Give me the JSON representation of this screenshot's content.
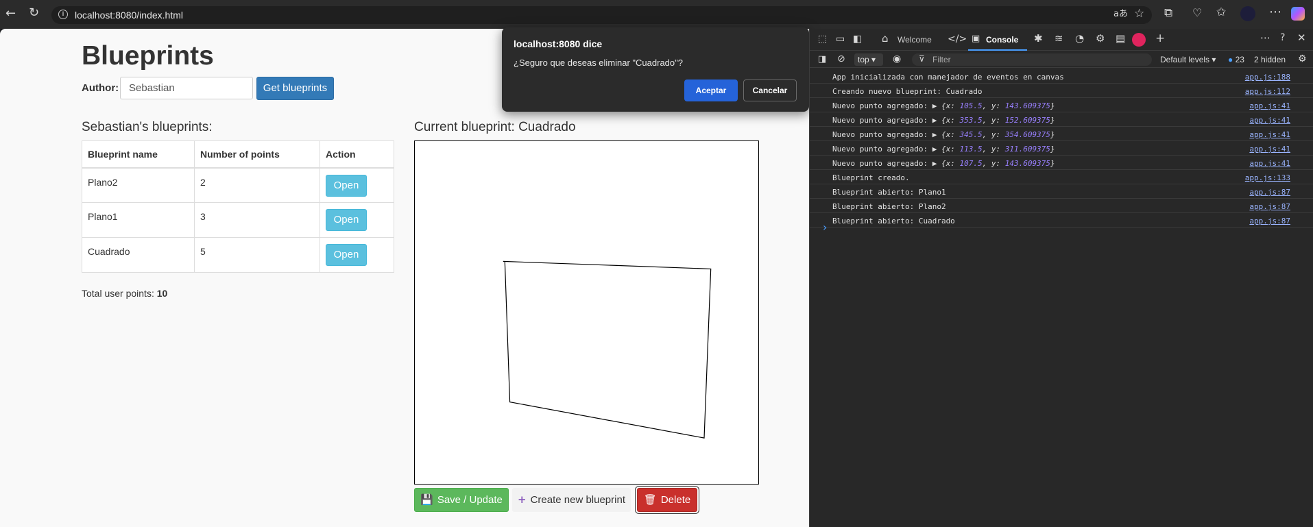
{
  "browser": {
    "url": "localhost:8080/index.html"
  },
  "page": {
    "title": "Blueprints",
    "author_label": "Author:",
    "author_value": "Sebastian",
    "get_button": "Get blueprints",
    "list_title": "Sebastian's blueprints:",
    "table": {
      "headers": [
        "Blueprint name",
        "Number of points",
        "Action"
      ],
      "rows": [
        {
          "name": "Plano2",
          "points": "2",
          "action": "Open"
        },
        {
          "name": "Plano1",
          "points": "3",
          "action": "Open"
        },
        {
          "name": "Cuadrado",
          "points": "5",
          "action": "Open"
        }
      ]
    },
    "total_label": "Total user points:",
    "total_value": "10",
    "current_title": "Current blueprint: Cuadrado",
    "canvas_points": [
      {
        "x": 105.5,
        "y": 143.609375
      },
      {
        "x": 353.5,
        "y": 152.609375
      },
      {
        "x": 345.5,
        "y": 354.609375
      },
      {
        "x": 113.5,
        "y": 311.609375
      },
      {
        "x": 107.5,
        "y": 143.609375
      }
    ],
    "save_button": "Save / Update",
    "new_button": "Create new blueprint",
    "delete_button": "Delete"
  },
  "dialog": {
    "title": "localhost:8080 dice",
    "message": "¿Seguro que deseas eliminar \"Cuadrado\"?",
    "ok": "Aceptar",
    "cancel": "Cancelar"
  },
  "devtools": {
    "tabs": [
      "Welcome",
      "Console"
    ],
    "context": "top",
    "filter_placeholder": "Filter",
    "levels": "Default levels",
    "issues_count": "23",
    "hidden": "2 hidden",
    "logs": [
      {
        "msg": "App inicializada con manejador de eventos en canvas",
        "src": "app.js:188"
      },
      {
        "msg": "Creando nuevo blueprint: Cuadrado",
        "src": "app.js:112"
      },
      {
        "msg": "Nuevo punto agregado: ",
        "x": "105.5",
        "y": "143.609375",
        "src": "app.js:41"
      },
      {
        "msg": "Nuevo punto agregado: ",
        "x": "353.5",
        "y": "152.609375",
        "src": "app.js:41"
      },
      {
        "msg": "Nuevo punto agregado: ",
        "x": "345.5",
        "y": "354.609375",
        "src": "app.js:41"
      },
      {
        "msg": "Nuevo punto agregado: ",
        "x": "113.5",
        "y": "311.609375",
        "src": "app.js:41"
      },
      {
        "msg": "Nuevo punto agregado: ",
        "x": "107.5",
        "y": "143.609375",
        "src": "app.js:41"
      },
      {
        "msg": "Blueprint creado.",
        "src": "app.js:133"
      },
      {
        "msg": "Blueprint abierto: Plano1",
        "src": "app.js:87"
      },
      {
        "msg": "Blueprint abierto: Plano2",
        "src": "app.js:87"
      },
      {
        "msg": "Blueprint abierto: Cuadrado",
        "src": "app.js:87"
      }
    ]
  }
}
